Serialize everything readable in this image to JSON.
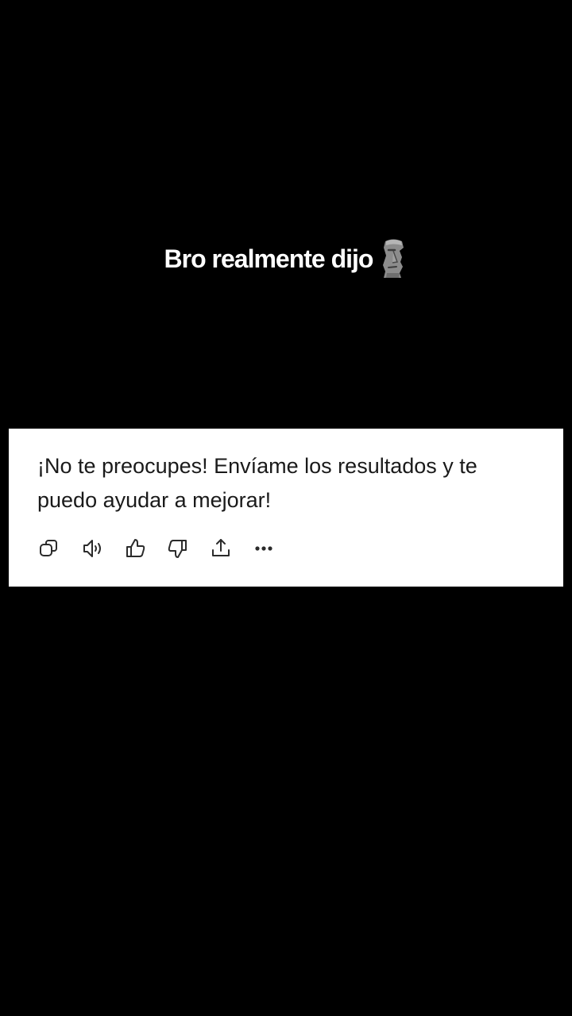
{
  "caption": {
    "text": "Bro realmente dijo",
    "emoji_icon": "moai-icon"
  },
  "message": {
    "text": "¡No te preocupes! Envíame los resultados y te puedo ayudar a mejorar!"
  },
  "actions": [
    {
      "icon": "copy-icon"
    },
    {
      "icon": "speaker-icon"
    },
    {
      "icon": "thumbs-up-icon"
    },
    {
      "icon": "thumbs-down-icon"
    },
    {
      "icon": "share-icon"
    },
    {
      "icon": "more-icon"
    }
  ],
  "colors": {
    "background": "#000000",
    "card": "#ffffff",
    "text": "#1a1a1a",
    "caption": "#ffffff"
  }
}
